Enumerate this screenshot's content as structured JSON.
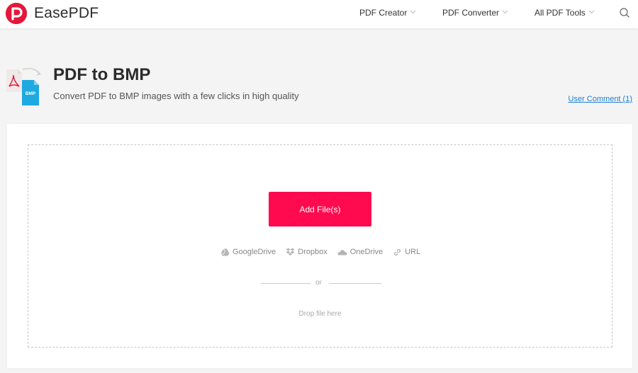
{
  "header": {
    "brand": "EasePDF",
    "nav": [
      {
        "label": "PDF Creator"
      },
      {
        "label": "PDF Converter"
      },
      {
        "label": "All PDF Tools"
      }
    ]
  },
  "tool": {
    "title": "PDF to BMP",
    "subtitle": "Convert PDF to BMP images with a few clicks in high quality",
    "icon_badge": "BMP",
    "user_comment": "User Comment (1)"
  },
  "upload": {
    "add_button": "Add File(s)",
    "sources": [
      {
        "label": "GoogleDrive",
        "icon": "google-drive-icon"
      },
      {
        "label": "Dropbox",
        "icon": "dropbox-icon"
      },
      {
        "label": "OneDrive",
        "icon": "onedrive-icon"
      },
      {
        "label": "URL",
        "icon": "link-icon"
      }
    ],
    "or_text": "or",
    "drop_text": "Drop file here"
  },
  "colors": {
    "brand": "#e4183a",
    "primary_button": "#ff0a4f",
    "link": "#1a7fd4",
    "bmp_icon": "#1fa9e1"
  }
}
